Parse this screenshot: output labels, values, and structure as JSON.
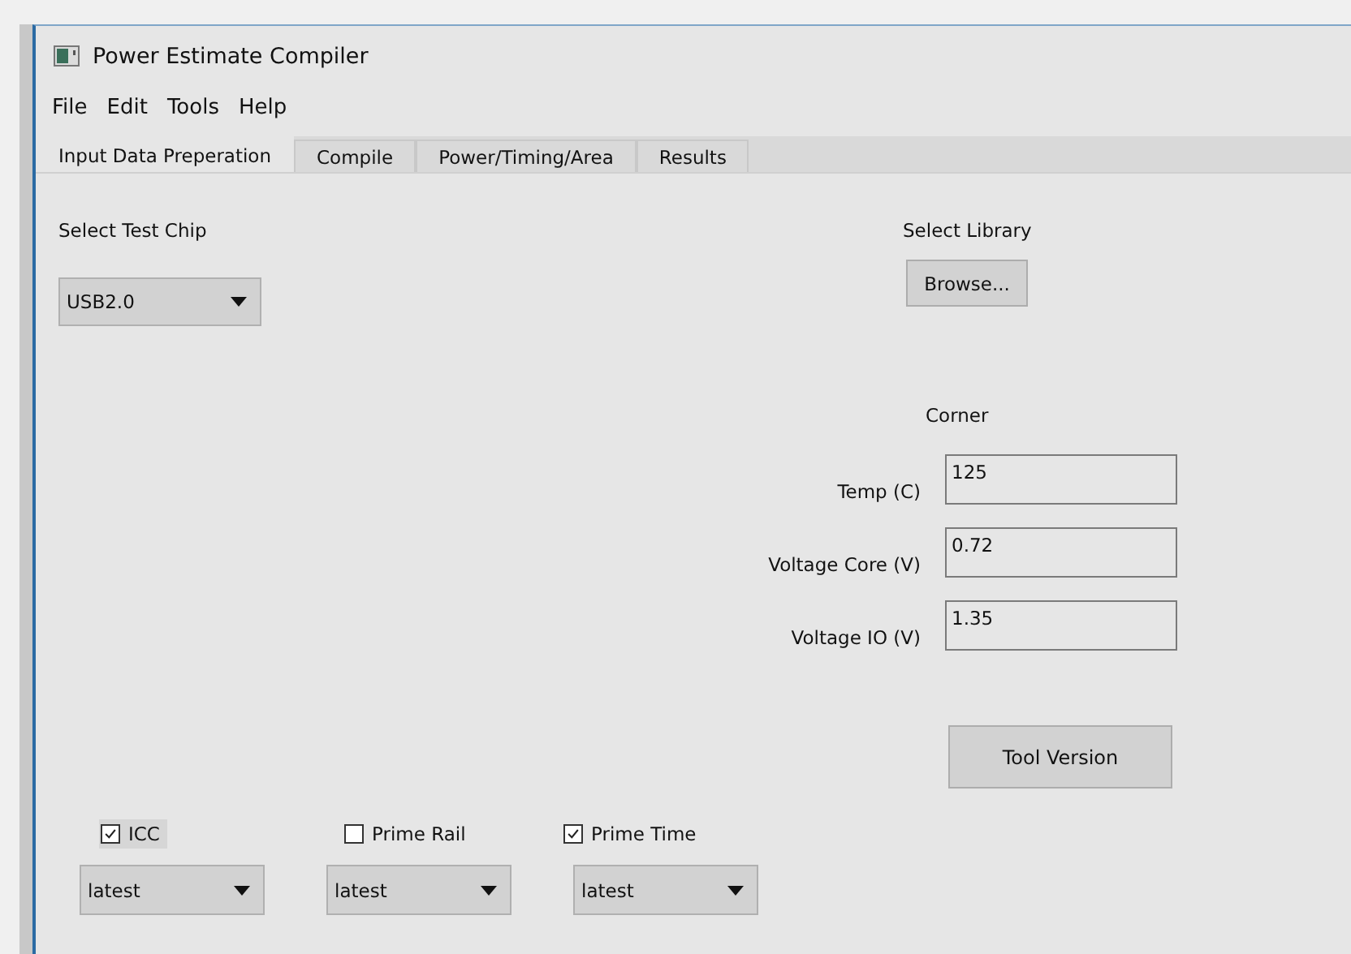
{
  "window": {
    "title": "Power Estimate Compiler"
  },
  "menu": [
    "File",
    "Edit",
    "Tools",
    "Help"
  ],
  "tabs": [
    {
      "label": "Input Data Preperation",
      "selected": true
    },
    {
      "label": "Compile",
      "selected": false
    },
    {
      "label": "Power/Timing/Area",
      "selected": false
    },
    {
      "label": "Results",
      "selected": false
    }
  ],
  "test_chip": {
    "label": "Select Test Chip",
    "value": "USB2.0"
  },
  "library": {
    "label": "Select Library",
    "button": "Browse..."
  },
  "corner": {
    "title": "Corner",
    "fields": [
      {
        "label": "Temp (C)",
        "value": "125"
      },
      {
        "label": "Voltage Core (V)",
        "value": "0.72"
      },
      {
        "label": "Voltage IO (V)",
        "value": "1.35"
      }
    ]
  },
  "tool_version_button": "Tool Version",
  "tools": [
    {
      "label": "ICC",
      "checked": true,
      "focused": true,
      "version": "latest"
    },
    {
      "label": "Prime Rail",
      "checked": false,
      "focused": false,
      "version": "latest"
    },
    {
      "label": "Prime Time",
      "checked": true,
      "focused": false,
      "version": "latest"
    }
  ]
}
